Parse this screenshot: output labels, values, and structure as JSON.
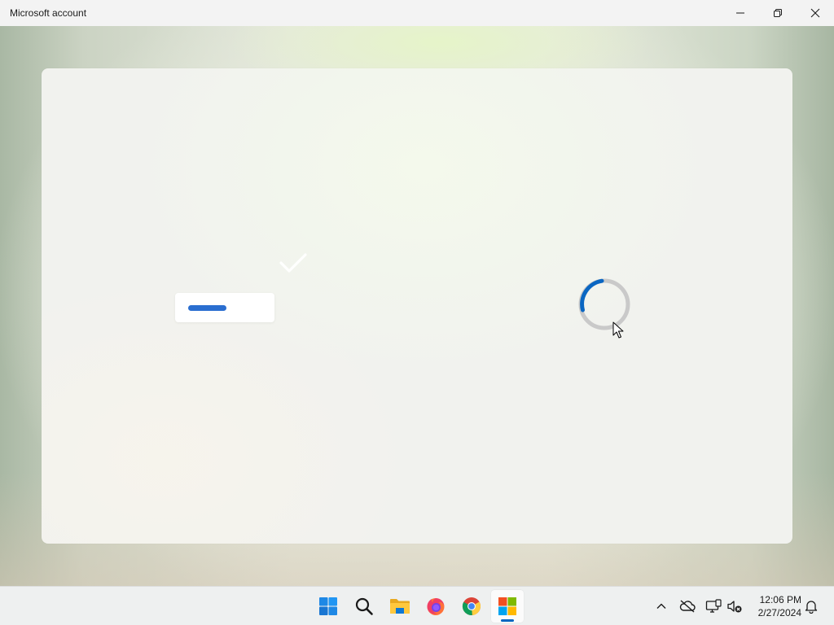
{
  "window": {
    "title": "Microsoft account"
  },
  "content": {
    "status": "loading",
    "accent_color": "#2a6ed0",
    "spinner_color": "#0a66c2",
    "spinner_track_color": "#c9c9c9"
  },
  "taskbar": {
    "apps": [
      {
        "name": "Start",
        "icon": "windows-start-icon"
      },
      {
        "name": "Search",
        "icon": "search-icon"
      },
      {
        "name": "File Explorer",
        "icon": "folder-icon"
      },
      {
        "name": "Firefox",
        "icon": "firefox-icon"
      },
      {
        "name": "Google Chrome",
        "icon": "chrome-icon"
      },
      {
        "name": "Microsoft account",
        "icon": "microsoft-logo-icon",
        "active": true
      }
    ],
    "tray": {
      "icons": [
        "chevron-up-icon",
        "cloud-offline-icon",
        "network-icon",
        "volume-muted-icon",
        "bell-icon"
      ],
      "time": "12:06 PM",
      "date": "2/27/2024"
    }
  }
}
